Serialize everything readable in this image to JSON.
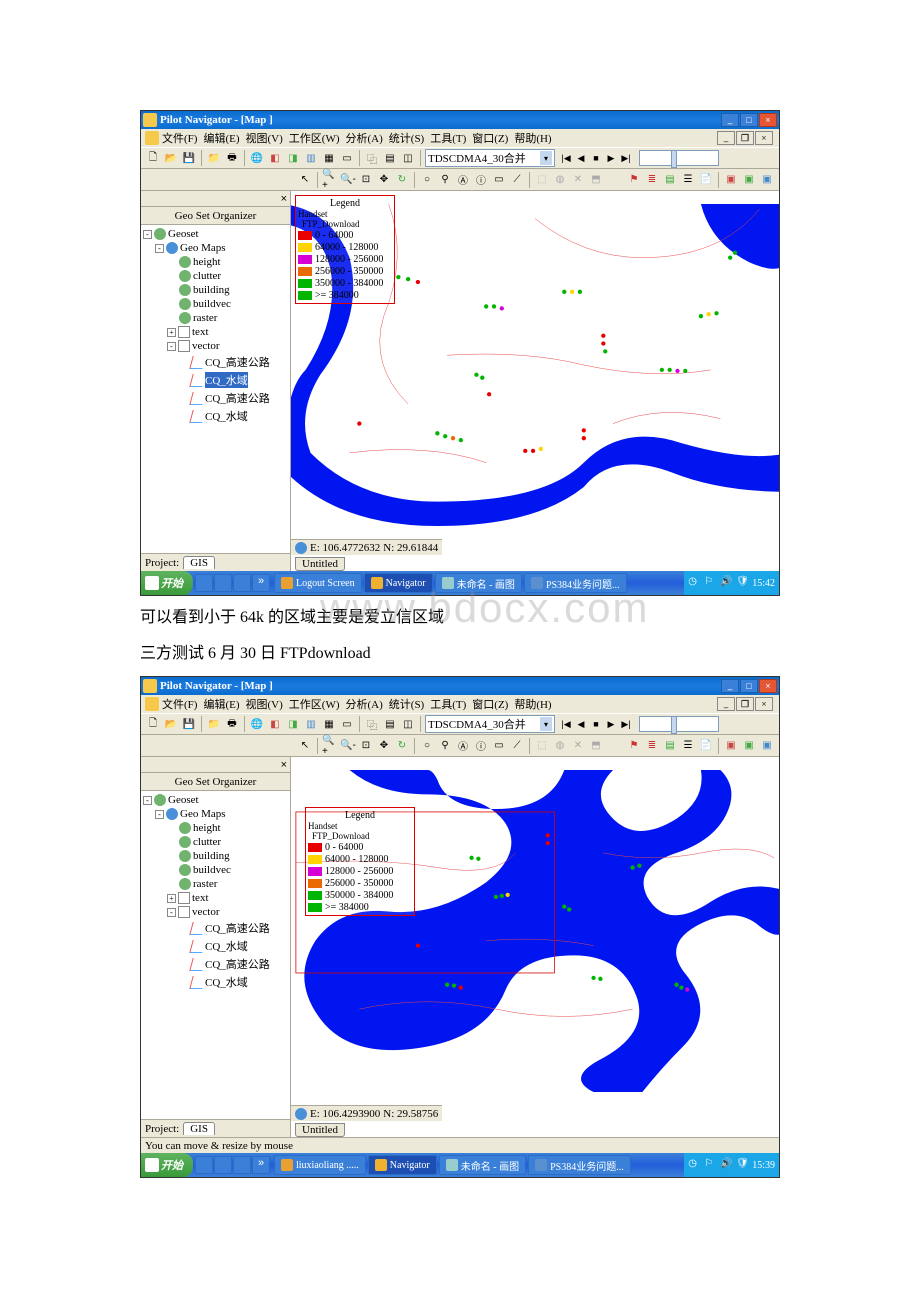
{
  "app": {
    "title": "Pilot Navigator - [Map ]",
    "menus": [
      "文件(F)",
      "编辑(E)",
      "视图(V)",
      "工作区(W)",
      "分析(A)",
      "统计(S)",
      "工具(T)",
      "窗口(Z)",
      "帮助(H)"
    ],
    "combo": "TDSCDMA4_30合并"
  },
  "sidebar": {
    "header": "Geo Set Organizer",
    "tree": {
      "root": "Geoset",
      "maps": "Geo Maps",
      "items": [
        "height",
        "clutter",
        "building",
        "buildvec",
        "raster"
      ],
      "text": "text",
      "vector": "vector",
      "vitems": [
        "CQ_高速公路",
        "CQ_水域",
        "CQ_高速公路",
        "CQ_水域"
      ],
      "selected": "CQ_水域"
    },
    "project_label": "Project:",
    "project_tab": "GIS"
  },
  "map1": {
    "legend_title": "Legend",
    "legend_group": "Handset",
    "legend_metric": "FTP_Download",
    "legend_rows": [
      {
        "color": "#e80000",
        "label": "0 - 64000"
      },
      {
        "color": "#ffd400",
        "label": "64000 - 128000"
      },
      {
        "color": "#d600d6",
        "label": "128000 - 256000"
      },
      {
        "color": "#e86a00",
        "label": "256000 - 350000"
      },
      {
        "color": "#00b400",
        "label": "350000 - 384000"
      },
      {
        "color": "#00b400",
        "label": ">= 384000"
      }
    ],
    "coords_e": "E: 106.4772632",
    "coords_n": "N: 29.61844",
    "bottom_tab": "Untitled"
  },
  "map2": {
    "legend_title": "Legend",
    "legend_group": "Handset",
    "legend_metric": "FTP_Download",
    "legend_rows": [
      {
        "color": "#e80000",
        "label": "0 - 64000"
      },
      {
        "color": "#ffd400",
        "label": "64000 - 128000"
      },
      {
        "color": "#d600d6",
        "label": "128000 - 256000"
      },
      {
        "color": "#e86a00",
        "label": "256000 - 350000"
      },
      {
        "color": "#00b400",
        "label": "350000 - 384000"
      },
      {
        "color": "#00b400",
        "label": ">= 384000"
      }
    ],
    "coords_e": "E: 106.4293900",
    "coords_n": "N: 29.58756",
    "bottom_tab": "Untitled",
    "hint": "You can move & resize by mouse"
  },
  "taskbar1": {
    "start": "开始",
    "tasks": [
      {
        "icon": "#e8a030",
        "label": "Logout Screen"
      },
      {
        "icon": "#f0b030",
        "label": "Navigator",
        "active": true
      },
      {
        "icon": "#9cc",
        "label": "未命名 - 画图"
      },
      {
        "icon": "#5a90d0",
        "label": "PS384业务问题..."
      }
    ],
    "time": "15:42"
  },
  "taskbar2": {
    "start": "开始",
    "tasks": [
      {
        "icon": "#e8a030",
        "label": "liuxiaoliang ....."
      },
      {
        "icon": "#f0b030",
        "label": "Navigator",
        "active": true
      },
      {
        "icon": "#9cc",
        "label": "未命名 - 画图"
      },
      {
        "icon": "#5a90d0",
        "label": "PS384业务问题..."
      }
    ],
    "time": "15:39"
  },
  "doc": {
    "line1": "可以看到小于 64k 的区域主要是爱立信区域",
    "line2": "三方测试 6 月 30 日 FTPdownload",
    "watermark": "www.bdocx.com"
  }
}
